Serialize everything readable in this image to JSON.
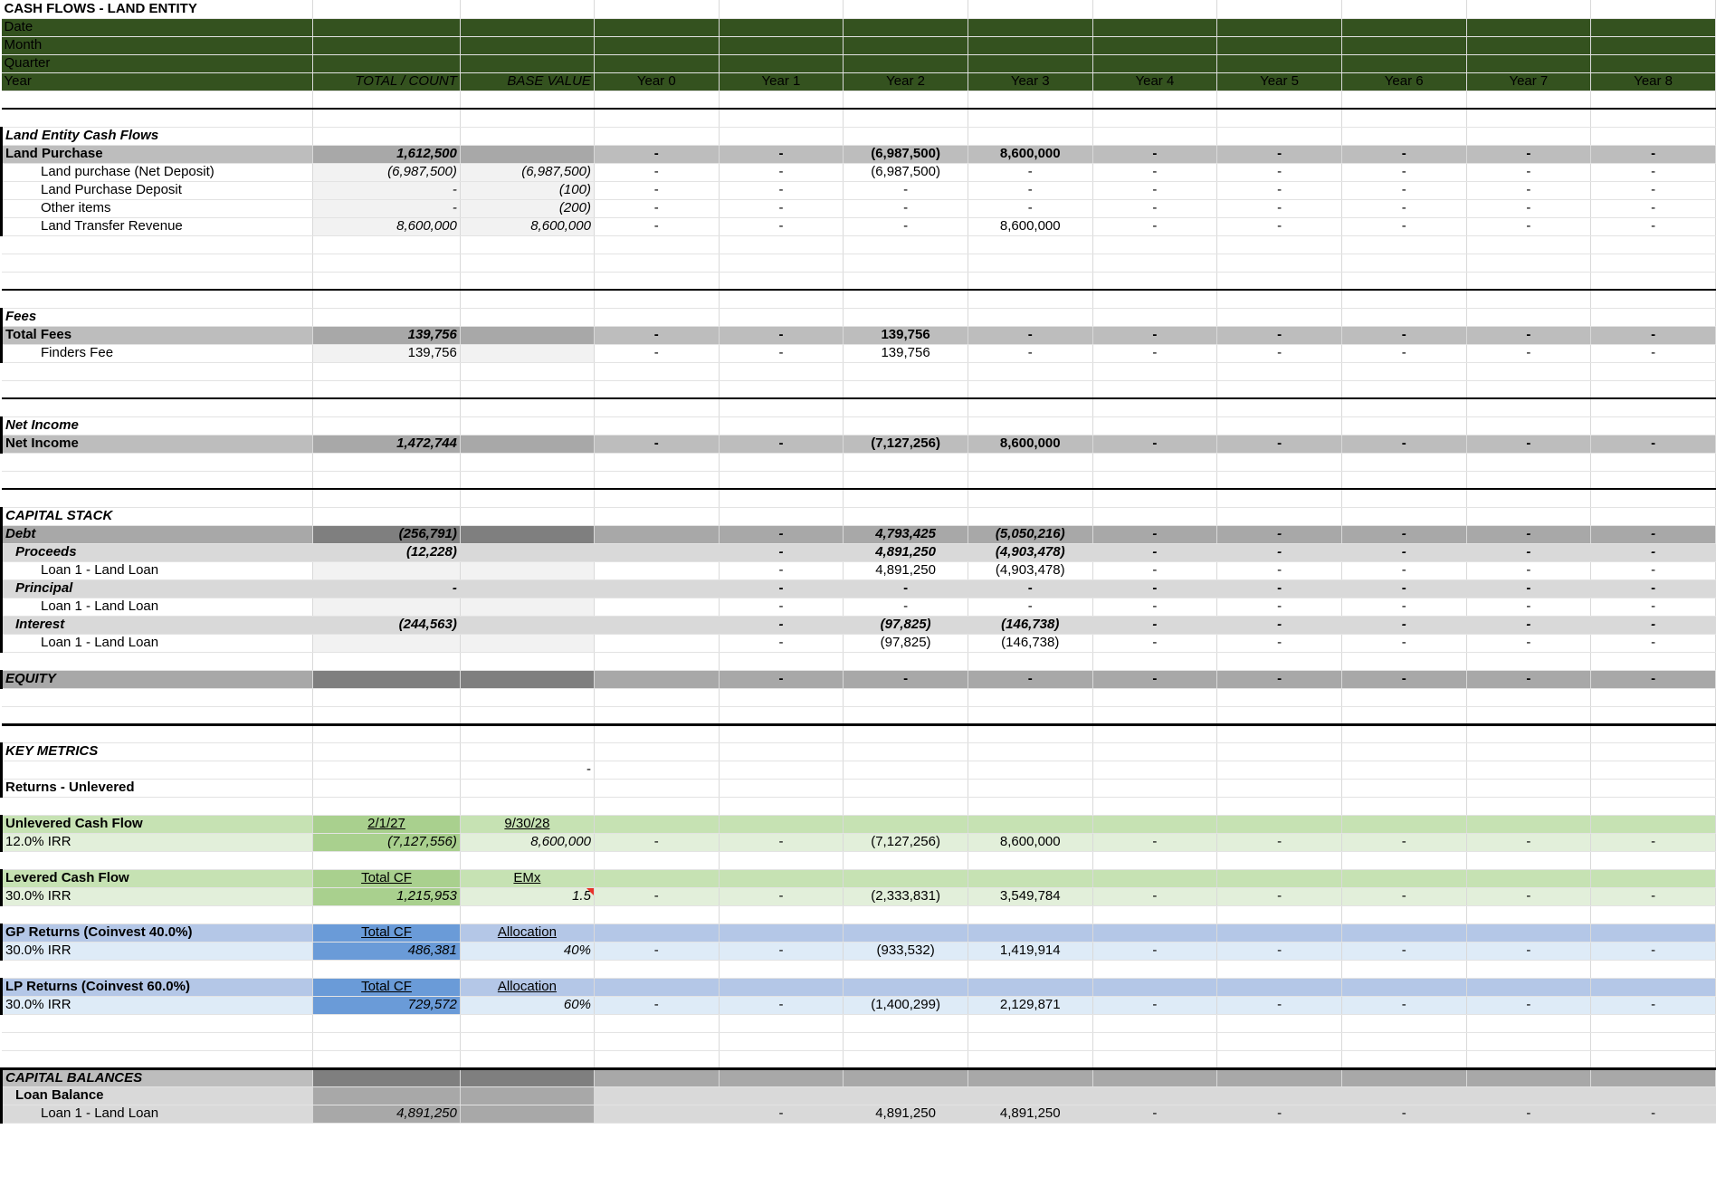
{
  "title": "CASH FLOWS - LAND ENTITY",
  "header": {
    "labels": [
      "Date",
      "Month",
      "Quarter",
      "Year"
    ],
    "total_count": "TOTAL / COUNT",
    "base_value": "BASE VALUE",
    "years": [
      "Year 0",
      "Year 1",
      "Year 2",
      "Year 3",
      "Year 4",
      "Year 5",
      "Year 6",
      "Year 7",
      "Year 8"
    ]
  },
  "land": {
    "section": "Land Entity Cash Flows",
    "rows": [
      {
        "label": "Land Purchase",
        "total": "1,612,500",
        "base": "",
        "vals": [
          "-",
          "-",
          "(6,987,500)",
          "8,600,000",
          "-",
          "-",
          "-",
          "-",
          "-"
        ]
      },
      {
        "label": "Land purchase (Net Deposit)",
        "total": "(6,987,500)",
        "base": "(6,987,500)",
        "vals": [
          "-",
          "-",
          "(6,987,500)",
          "-",
          "-",
          "-",
          "-",
          "-",
          "-"
        ]
      },
      {
        "label": "Land Purchase Deposit",
        "total": "-",
        "base": "(100)",
        "vals": [
          "-",
          "-",
          "-",
          "-",
          "-",
          "-",
          "-",
          "-",
          "-"
        ]
      },
      {
        "label": "Other items",
        "total": "-",
        "base": "(200)",
        "vals": [
          "-",
          "-",
          "-",
          "-",
          "-",
          "-",
          "-",
          "-",
          "-"
        ]
      },
      {
        "label": "Land Transfer Revenue",
        "total": "8,600,000",
        "base": "8,600,000",
        "vals": [
          "-",
          "-",
          "-",
          "8,600,000",
          "-",
          "-",
          "-",
          "-",
          "-"
        ]
      }
    ]
  },
  "fees": {
    "section": "Fees",
    "rows": [
      {
        "label": "Total Fees",
        "total": "139,756",
        "base": "",
        "vals": [
          "-",
          "-",
          "139,756",
          "-",
          "-",
          "-",
          "-",
          "-",
          "-"
        ]
      },
      {
        "label": "Finders Fee",
        "total": "139,756",
        "base": "",
        "vals": [
          "-",
          "-",
          "139,756",
          "-",
          "-",
          "-",
          "-",
          "-",
          "-"
        ]
      }
    ]
  },
  "net": {
    "section": "Net Income",
    "rows": [
      {
        "label": "Net Income",
        "total": "1,472,744",
        "base": "",
        "vals": [
          "-",
          "-",
          "(7,127,256)",
          "8,600,000",
          "-",
          "-",
          "-",
          "-",
          "-"
        ]
      }
    ]
  },
  "capital": {
    "section": "CAPITAL STACK",
    "rows": [
      {
        "label": "Debt",
        "total": "(256,791)",
        "base": "",
        "vals": [
          "",
          "-",
          "4,793,425",
          "(5,050,216)",
          "-",
          "-",
          "-",
          "-",
          "-"
        ]
      },
      {
        "label": "Proceeds",
        "total": "(12,228)",
        "base": "",
        "vals": [
          "",
          "-",
          "4,891,250",
          "(4,903,478)",
          "-",
          "-",
          "-",
          "-",
          "-"
        ]
      },
      {
        "label": "Loan 1 - Land Loan",
        "total": "",
        "base": "",
        "vals": [
          "",
          "-",
          "4,891,250",
          "(4,903,478)",
          "-",
          "-",
          "-",
          "-",
          "-"
        ]
      },
      {
        "label": "Principal",
        "total": "-",
        "base": "",
        "vals": [
          "",
          "-",
          "-",
          "-",
          "-",
          "-",
          "-",
          "-",
          "-"
        ]
      },
      {
        "label": "Loan 1 - Land Loan",
        "total": "",
        "base": "",
        "vals": [
          "",
          "-",
          "-",
          "-",
          "-",
          "-",
          "-",
          "-",
          "-"
        ]
      },
      {
        "label": "Interest",
        "total": "(244,563)",
        "base": "",
        "vals": [
          "",
          "-",
          "(97,825)",
          "(146,738)",
          "-",
          "-",
          "-",
          "-",
          "-"
        ]
      },
      {
        "label": "Loan 1 - Land Loan",
        "total": "",
        "base": "",
        "vals": [
          "",
          "-",
          "(97,825)",
          "(146,738)",
          "-",
          "-",
          "-",
          "-",
          "-"
        ]
      }
    ],
    "equity": {
      "label": "EQUITY",
      "vals": [
        "",
        "-",
        "-",
        "-",
        "-",
        "-",
        "-",
        "-",
        "-"
      ]
    }
  },
  "metrics": {
    "section": "KEY METRICS",
    "dash": "-",
    "returns_label": "Returns - Unlevered",
    "unlevered": {
      "label": "Unlevered Cash Flow",
      "h1": "2/1/27",
      "h2": "9/30/28",
      "irr": "12.0% IRR",
      "total": "(7,127,556)",
      "base": "8,600,000",
      "vals": [
        "-",
        "-",
        "(7,127,256)",
        "8,600,000",
        "-",
        "-",
        "-",
        "-",
        "-"
      ]
    },
    "levered": {
      "label": "Levered Cash Flow",
      "h1": "Total CF",
      "h2": "EMx",
      "irr": "30.0% IRR",
      "total": "1,215,953",
      "base": "1.5",
      "vals": [
        "-",
        "-",
        "(2,333,831)",
        "3,549,784",
        "-",
        "-",
        "-",
        "-",
        "-"
      ]
    },
    "gp": {
      "label": "GP Returns (Coinvest 40.0%)",
      "h1": "Total CF",
      "h2": "Allocation",
      "irr": "30.0% IRR",
      "total": "486,381",
      "base": "40%",
      "vals": [
        "-",
        "-",
        "(933,532)",
        "1,419,914",
        "-",
        "-",
        "-",
        "-",
        "-"
      ]
    },
    "lp": {
      "label": "LP Returns (Coinvest 60.0%)",
      "h1": "Total CF",
      "h2": "Allocation",
      "irr": "30.0% IRR",
      "total": "729,572",
      "base": "60%",
      "vals": [
        "-",
        "-",
        "(1,400,299)",
        "2,129,871",
        "-",
        "-",
        "-",
        "-",
        "-"
      ]
    }
  },
  "balances": {
    "section": "CAPITAL BALANCES",
    "loan_balance": "Loan Balance",
    "loan": {
      "label": "Loan 1 - Land Loan",
      "total": "4,891,250",
      "vals": [
        "",
        "-",
        "4,891,250",
        "4,891,250",
        "-",
        "-",
        "-",
        "-",
        "-"
      ]
    }
  },
  "colors": {
    "header_bg": "#34521f",
    "section_red": "#e8322a",
    "green": "#c6e2b3",
    "blue": "#b4c7e7"
  }
}
